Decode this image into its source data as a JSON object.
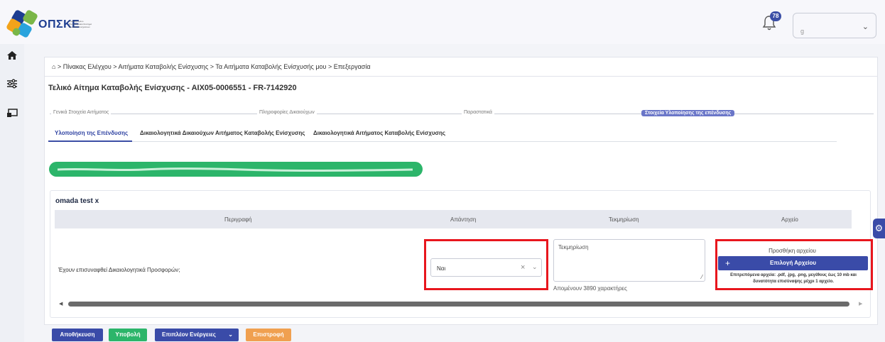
{
  "header": {
    "logo_text": "ΟΠΣΚΕ",
    "logo_subtitle": "Ολοκληρωμένο Πληροφοριακό Σύστημα Κρατικών Ενισχύσεων",
    "notification_count": "78",
    "user_placeholder": "g"
  },
  "breadcrumb": "⌂ > Πίνακας Ελέγχου > Αιτήματα Καταβολής Ενίσχυσης > Τα Αιτήματα Καταβολής Ενίσχυσής μου > Επεξεργασία",
  "page_title": "Τελικό Αίτημα Καταβολής Ενίσχυσης - ΑΙΧ05-0006551 - FR-7142920",
  "steps": [
    {
      "label": "Γενικά Στοιχεία Αιτήματος"
    },
    {
      "label": "Πληροφορίες Δικαιούχων"
    },
    {
      "label": "Παραστατικά"
    },
    {
      "label": "Στοιχεία Υλοποίησης της επένδυσης"
    }
  ],
  "tabs": [
    {
      "label": "Υλοποίηση της Επένδυσης"
    },
    {
      "label": "Δικαιολογητικά Δικαιούχων Αιτήματος Καταβολής Ενίσχυσης"
    },
    {
      "label": "Δικαιολογητικά Αιτήματος Καταβολής Ενίσχυσης"
    }
  ],
  "group": {
    "title": "omada test x",
    "columns": [
      "Περιγραφή",
      "Απάντηση",
      "Τεκμηρίωση",
      "Αρχείο"
    ],
    "row": {
      "description": "Έχουν επισυναφθεί Δικαιολογητικά Προσφορών;",
      "answer": "Ναι",
      "justification_placeholder": "Τεκμηρίωση",
      "remaining": "Απομένουν 3890 χαρακτήρες",
      "add_file_label": "Προσθήκη αρχείου",
      "choose_file_label": "Επιλογή Αρχείου",
      "file_help": "Επιτρεπόμενα αρχεία: .pdf, .jpg, .png, μεγέθους έως 10 mb και δυνατότητα επισύναψης μέχρι 1 αρχείο."
    }
  },
  "buttons": {
    "save": "Αποθήκευση",
    "submit": "Υποβολή",
    "more": "Επιπλέον Ενέργειες",
    "back": "Επιστροφή"
  },
  "colors": {
    "primary": "#3a4ba8",
    "success": "#2cb56a",
    "warning": "#f0a050",
    "highlight": "#e8161d"
  }
}
